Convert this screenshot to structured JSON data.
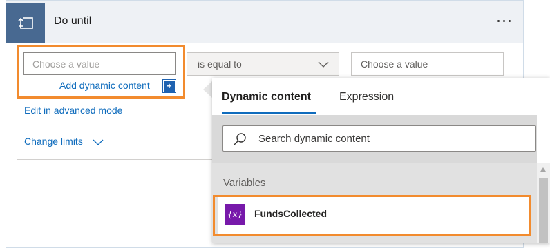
{
  "header": {
    "title": "Do until",
    "more_label": "..."
  },
  "condition": {
    "left_placeholder": "Choose a value",
    "add_dynamic_label": "Add dynamic content",
    "add_plus": "+",
    "operator": "is equal to",
    "right_placeholder": "Choose a value"
  },
  "links": {
    "advanced": "Edit in advanced mode",
    "limits": "Change limits"
  },
  "flyout": {
    "tabs": [
      {
        "label": "Dynamic content",
        "active": true
      },
      {
        "label": "Expression",
        "active": false
      }
    ],
    "search_placeholder": "Search dynamic content",
    "section_title": "Variables",
    "items": [
      {
        "label": "FundsCollected",
        "badge": "{x}",
        "type": "variable"
      }
    ]
  },
  "colors": {
    "accent": "#0f6cbd",
    "header_icon_bg": "#486991",
    "highlight": "#f28b2e",
    "variable_badge": "#7719aa"
  },
  "icons": {
    "header": "loop-icon",
    "operator_chevron": "chevron-down-icon",
    "limits_chevron": "chevron-down-icon",
    "search": "search-icon"
  }
}
